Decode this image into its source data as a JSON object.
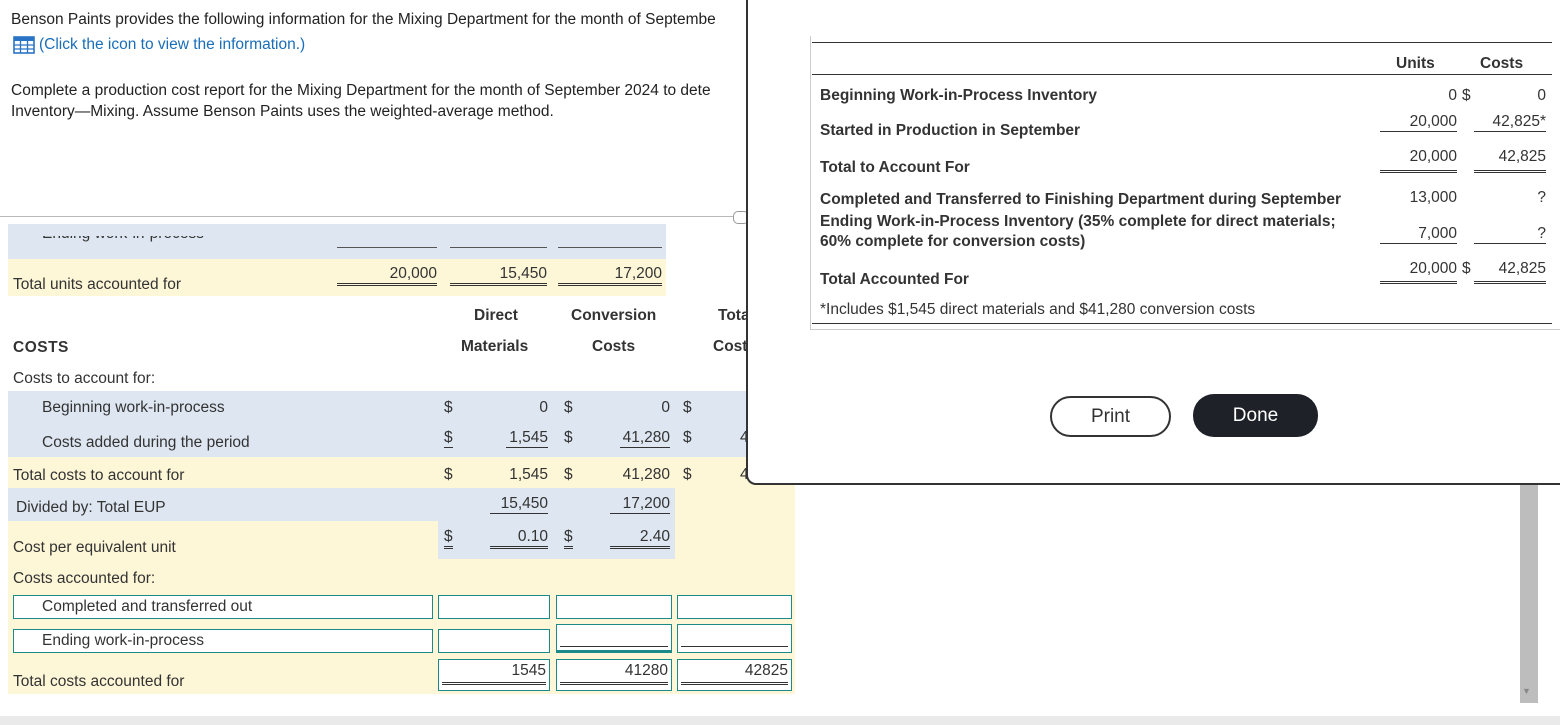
{
  "intro": "Benson Paints provides the following information for the Mixing Department for the month of Septembe",
  "link_text": "(Click the icon to view the information.)",
  "task_line1": "Complete a production cost report for the Mixing Department for the month of September 2024 to dete",
  "task_line2": "Inventory—Mixing. Assume Benson Paints uses the weighted-average method.",
  "partial_row_label": "Ending work-in-process",
  "units": {
    "total_label": "Total units accounted for",
    "total": "20,000",
    "dm": "15,450",
    "cc": "17,200"
  },
  "headers": {
    "dm1": "Direct",
    "dm2": "Materials",
    "cc1": "Conversion",
    "cc2": "Costs",
    "tot1": "Tota",
    "tot2": "Cost"
  },
  "costs_title": "COSTS",
  "costs_to_account_label": "Costs to account for:",
  "rows": {
    "beg_label": "Beginning work-in-process",
    "beg_dm": "0",
    "beg_cc": "0",
    "added_label": "Costs added during the period",
    "added_dm": "1,545",
    "added_cc": "41,280",
    "added_tot": "4",
    "total_label": "Total costs to account for",
    "total_dm": "1,545",
    "total_cc": "41,280",
    "total_tot": "4",
    "eup_label": "Divided by: Total EUP",
    "eup_dm": "15,450",
    "eup_cc": "17,200",
    "cpu_label": "Cost per equivalent unit",
    "cpu_dm": "0.10",
    "cpu_cc": "2.40"
  },
  "dollar": "$",
  "accounted": {
    "title": "Costs accounted for:",
    "completed_label": "Completed and transferred out",
    "ending_label": "Ending work-in-process",
    "total_label": "Total costs accounted for",
    "total_dm": "1545",
    "total_cc": "41280",
    "total_tot": "42825"
  },
  "modal": {
    "col_units": "Units",
    "col_costs": "Costs",
    "r1_label": "Beginning Work-in-Process Inventory",
    "r1_units": "0",
    "r1_costs": "0",
    "r2_label": "Started in Production in September",
    "r2_units": "20,000",
    "r2_costs": "42,825*",
    "r3_label": "Total to Account For",
    "r3_units": "20,000",
    "r3_costs": "42,825",
    "r4_label": "Completed and Transferred to Finishing Department during September",
    "r4_units": "13,000",
    "r4_costs": "?",
    "r5_label1": "Ending Work-in-Process Inventory (35% complete for direct materials;",
    "r5_label2": "60% complete for conversion costs)",
    "r5_units": "7,000",
    "r5_costs": "?",
    "r6_label": "Total Accounted For",
    "r6_units": "20,000",
    "r6_costs": "42,825",
    "footnote": "*Includes $1,545 direct materials and $41,280 conversion costs",
    "print": "Print",
    "done": "Done"
  }
}
